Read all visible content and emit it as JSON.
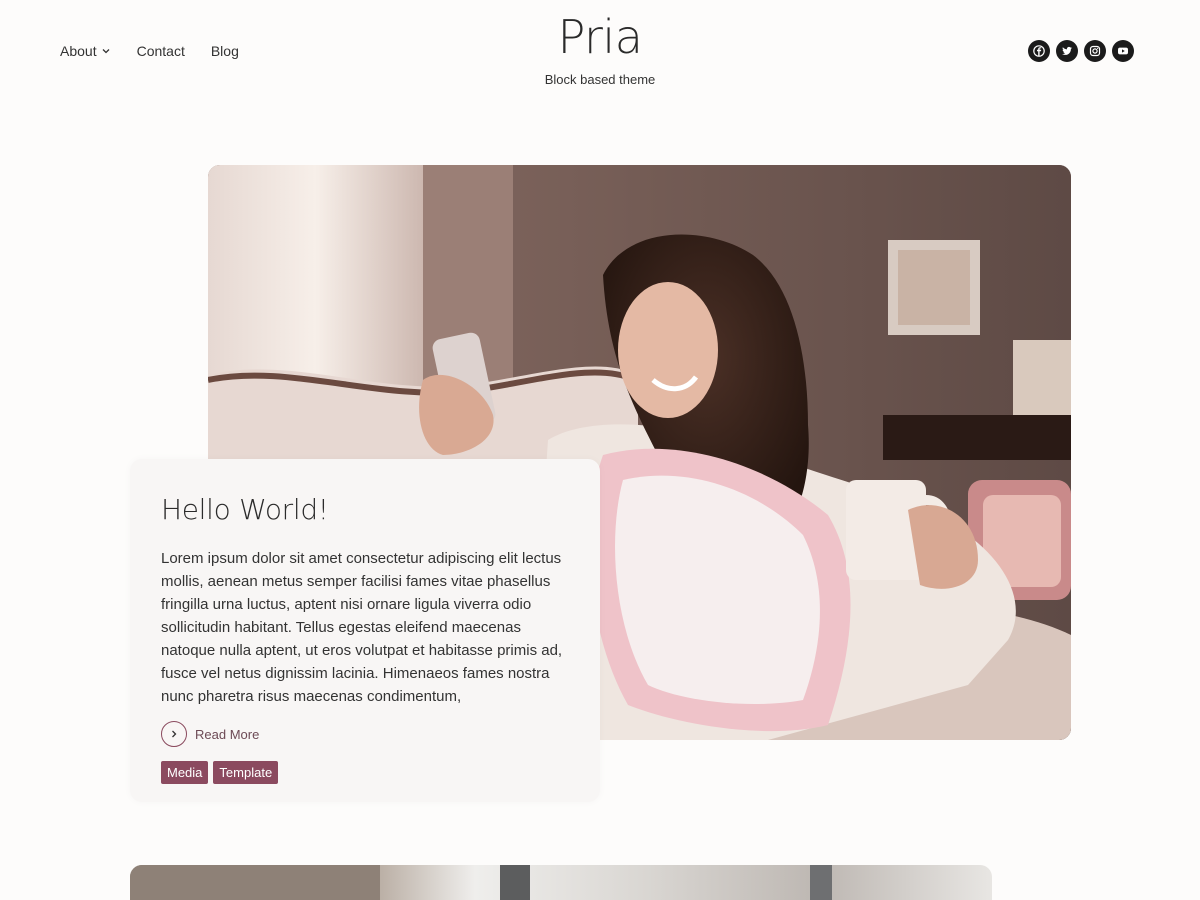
{
  "header": {
    "nav": [
      {
        "label": "About",
        "has_dropdown": true,
        "icon": "chevron-down-icon"
      },
      {
        "label": "Contact"
      },
      {
        "label": "Blog"
      }
    ],
    "site_title": "Pria",
    "tagline": "Block based theme",
    "socials": [
      {
        "icon": "facebook-icon"
      },
      {
        "icon": "twitter-icon"
      },
      {
        "icon": "instagram-icon"
      },
      {
        "icon": "youtube-icon"
      }
    ]
  },
  "post": {
    "title": "Hello World!",
    "excerpt": "Lorem ipsum dolor sit amet consectetur adipiscing elit lectus mollis, aenean metus semper facilisi fames vitae phasellus fringilla urna luctus, aptent nisi ornare ligula viverra odio sollicitudin habitant. Tellus egestas eleifend maecenas natoque nulla aptent, ut eros volutpat et habitasse primis ad, fusce vel netus dignissim lacinia. Himenaeos fames nostra nunc pharetra risus maecenas condimentum,",
    "read_more": "Read More",
    "tags": [
      "Media",
      "Template"
    ]
  },
  "colors": {
    "accent": "#8b4a5f",
    "text": "#2b2b2b",
    "background": "#fdfcfb",
    "card": "#f8f6f5"
  }
}
